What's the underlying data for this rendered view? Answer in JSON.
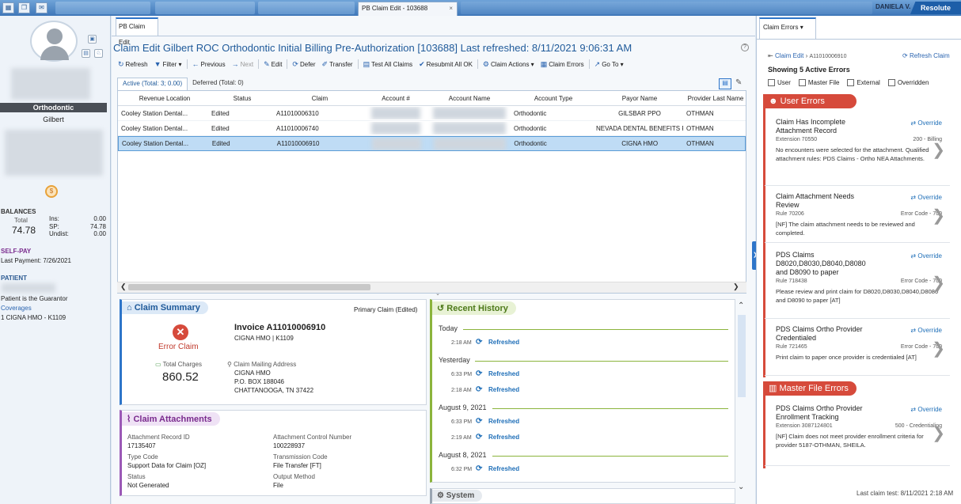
{
  "topbar": {
    "active_tab": "PB Claim Edit - 103688",
    "close": "×",
    "user": "DANIELA V.",
    "brand": "Resolute"
  },
  "left": {
    "specialty": "Orthodontic",
    "location": "Gilbert",
    "balances_label": "BALANCES",
    "total_label": "Total",
    "total_value": "74.78",
    "ins_label": "Ins:",
    "ins_value": "0.00",
    "sp_label": "SP:",
    "sp_value": "74.78",
    "undist_label": "Undist:",
    "undist_value": "0.00",
    "selfpay_label": "SELF-PAY",
    "last_payment": "Last Payment: 7/26/2021",
    "patient_label": "PATIENT",
    "guarantor": "Patient is the Guarantor",
    "coverages": "Coverages",
    "coverage_item": "1  CIGNA HMO - K1109"
  },
  "main": {
    "tab": "PB Claim Edit",
    "title": "Claim Edit Gilbert ROC Orthodontic Initial Billing Pre-Authorization [103688] Last refreshed: 8/11/2021 9:06:31 AM",
    "toolbar": [
      {
        "icon": "↻",
        "label": "Refresh"
      },
      {
        "icon": "▼",
        "label": "Filter ▾"
      },
      {
        "icon": "←",
        "label": "Previous"
      },
      {
        "icon": "→",
        "label": "Next"
      },
      {
        "icon": "✎",
        "label": "Edit"
      },
      {
        "icon": "⟳",
        "label": "Defer"
      },
      {
        "icon": "✐",
        "label": "Transfer"
      },
      {
        "icon": "▤",
        "label": "Test All Claims"
      },
      {
        "icon": "✔",
        "label": "Resubmit All OK"
      },
      {
        "icon": "⚙",
        "label": "Claim Actions ▾"
      },
      {
        "icon": "▦",
        "label": "Claim Errors"
      },
      {
        "icon": "↗",
        "label": "Go To ▾"
      }
    ],
    "subtabs": {
      "active": "Active (Total: 3; 0.00)",
      "deferred": "Deferred (Total: 0)"
    },
    "columns": [
      "Revenue Location",
      "Status",
      "Claim",
      "Account #",
      "Account Name",
      "Account Type",
      "Payor Name",
      "Provider Last Name"
    ],
    "rows": [
      [
        "Cooley Station Dental...",
        "Edited",
        "A11010006310",
        "",
        "",
        "Orthodontic",
        "GILSBAR PPO",
        "OTHMAN"
      ],
      [
        "Cooley Station Dental...",
        "Edited",
        "A11010006740",
        "",
        "",
        "Orthodontic",
        "NEVADA DENTAL BENEFITS PPO",
        "OTHMAN"
      ],
      [
        "Cooley Station Dental...",
        "Edited",
        "A11010006910",
        "",
        "",
        "Orthodontic",
        "CIGNA HMO",
        "OTHMAN"
      ]
    ]
  },
  "summary": {
    "title": "Claim Summary",
    "primary": "Primary Claim (Edited)",
    "error_label": "Error Claim",
    "charges_label": "Total Charges",
    "charges_value": "860.52",
    "invoice": "Invoice A11010006910",
    "invoice_sub": "CIGNA HMO | K1109",
    "mailing_label": "Claim Mailing Address",
    "addr1": "CIGNA HMO",
    "addr2": "P.O. BOX 188046",
    "addr3": "CHATTANOOGA, TN 37422"
  },
  "attachments": {
    "title": "Claim Attachments",
    "rec_id_label": "Attachment Record ID",
    "rec_id": "17135407",
    "ctrl_label": "Attachment Control Number",
    "ctrl": "100228937",
    "type_label": "Type Code",
    "type": "Support Data for Claim [OZ]",
    "trans_label": "Transmission Code",
    "trans": "File Transfer [FT]",
    "status_label": "Status",
    "status": "Not Generated",
    "output_label": "Output Method",
    "output": "File"
  },
  "history": {
    "title": "Recent History",
    "groups": [
      {
        "day": "Today",
        "items": [
          {
            "time": "2:18 AM",
            "text": "Refreshed"
          }
        ]
      },
      {
        "day": "Yesterday",
        "items": [
          {
            "time": "6:33 PM",
            "text": "Refreshed"
          },
          {
            "time": "2:18 AM",
            "text": "Refreshed"
          }
        ]
      },
      {
        "day": "August 9, 2021",
        "items": [
          {
            "time": "6:33 PM",
            "text": "Refreshed"
          },
          {
            "time": "2:19 AM",
            "text": "Refreshed"
          }
        ]
      },
      {
        "day": "August 8, 2021",
        "items": [
          {
            "time": "6:32 PM",
            "text": "Refreshed"
          }
        ]
      }
    ],
    "system": "System"
  },
  "errors": {
    "tab": "Claim Errors",
    "crumb1": "Claim Edit",
    "crumb2": "A11010006910",
    "refresh": "Refresh Claim",
    "showing": "Showing 5 Active Errors",
    "filters": [
      "User",
      "Master File",
      "External",
      "Overridden"
    ],
    "user_errors": "User Errors",
    "master_errors": "Master File Errors",
    "override": "Override",
    "cards": [
      {
        "title": "Claim Has Incomplete Attachment Record",
        "left": "Extension 70550",
        "right": "200 - Billing",
        "msg": "No encounters were selected for the attachment. Qualified attachment rules: PDS Claims - Ortho NEA Attachments."
      },
      {
        "title": "Claim Attachment Needs Review",
        "left": "Rule 70206",
        "right": "Error Code - 700",
        "msg": "[NF] The claim attachment needs to be reviewed and completed."
      },
      {
        "title": "PDS Claims D8020,D8030,D8040,D8080 and D8090 to paper",
        "left": "Rule 718438",
        "right": "Error Code - 700",
        "msg": "Please review and print claim for D8020,D8030,D8040,D8080 and D8090 to paper [AT]"
      },
      {
        "title": "PDS Claims Ortho Provider Credentialed",
        "left": "Rule 721465",
        "right": "Error Code - 700",
        "msg": "Print claim to paper once provider is credentialed [AT]"
      },
      {
        "title": "PDS Claims Ortho Provider Enrollment Tracking",
        "left": "Extension 3087124801",
        "right": "500 - Credentialing",
        "msg": "[NF] Claim does not meet provider enrollment criteria for provider 5187-OTHMAN, SHEILA."
      }
    ],
    "last_test": "Last claim test: 8/11/2021 2:18 AM"
  }
}
